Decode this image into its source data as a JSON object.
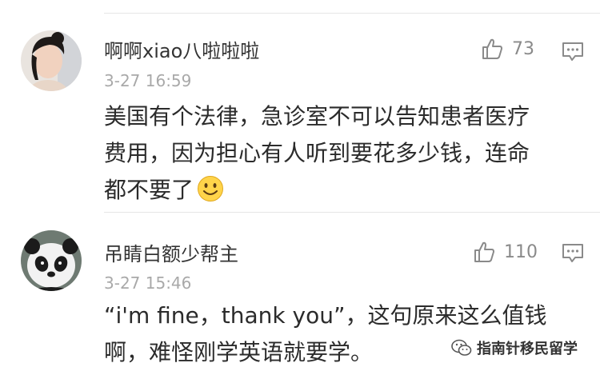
{
  "comments": [
    {
      "username": "啊啊xiao八啦啦啦",
      "time": "3-27 16:59",
      "likes": "73",
      "lines": [
        "美国有个法律，急诊室不可以告知患者医疗",
        "费用，因为担心有人听到要花多少钱，连命",
        "都不要了"
      ],
      "emoji": "smile-emoji"
    },
    {
      "username": "吊睛白额少帮主",
      "time": "3-27 15:46",
      "likes": "110",
      "lines": [
        "“i'm fine，thank you”，这句原来这么值钱",
        "啊，难怪刚学英语就要学。"
      ]
    }
  ],
  "watermark": {
    "text": "指南针移民留学"
  },
  "colors": {
    "like": "#8a8a8a",
    "time": "#a9a9a9",
    "divider": "#e6e6e6"
  }
}
